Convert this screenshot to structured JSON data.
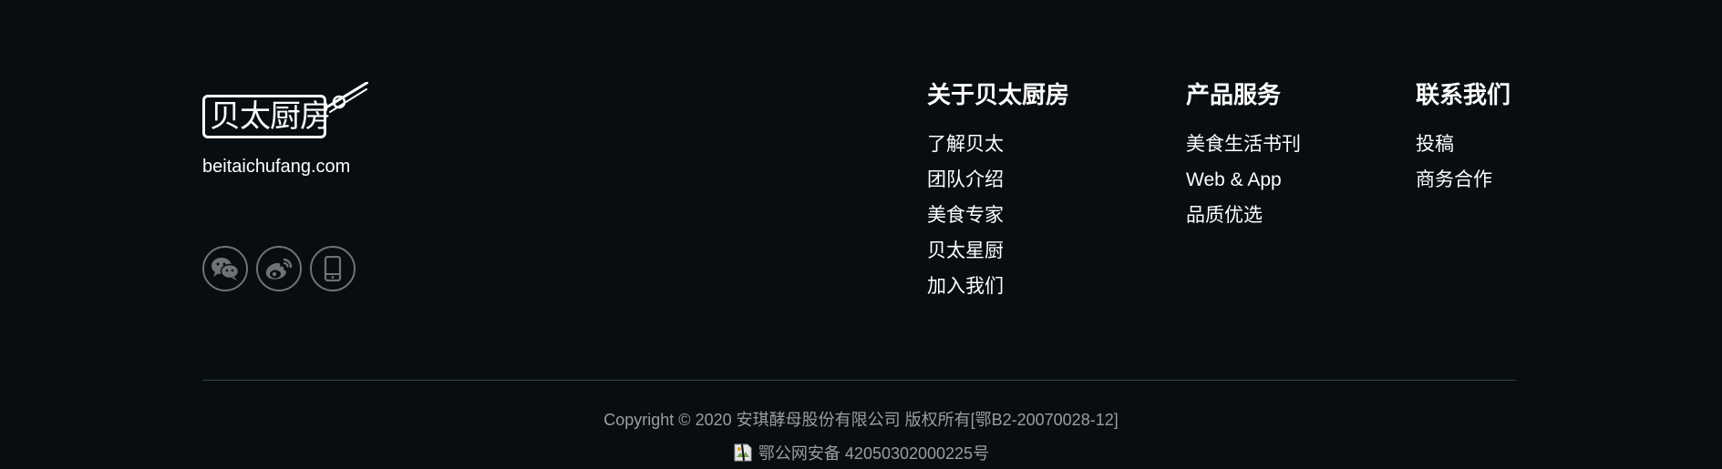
{
  "brand": {
    "logo_text": "贝太厨房",
    "domain": "beitaichufang.com"
  },
  "socials": [
    {
      "icon": "wechat-icon"
    },
    {
      "icon": "weibo-icon"
    },
    {
      "icon": "mobile-icon"
    }
  ],
  "columns": {
    "about": {
      "title": "关于贝太厨房",
      "links": [
        "了解贝太",
        "团队介绍",
        "美食专家",
        "贝太星厨",
        "加入我们"
      ]
    },
    "products": {
      "title": "产品服务",
      "links": [
        "美食生活书刊",
        "Web & App",
        "品质优选"
      ]
    },
    "contact": {
      "title": "联系我们",
      "links": [
        "投稿",
        "商务合作"
      ]
    }
  },
  "legal": {
    "copyright": "Copyright © 2020 安琪酵母股份有限公司 版权所有[鄂B2-20070028-12]",
    "police_record": "鄂公网安备 42050302000225号"
  },
  "colors": {
    "background": "#070d10",
    "text": "#ffffff",
    "muted": "#9a9ea0",
    "icon_border": "#6e7376",
    "divider": "#3c4346"
  }
}
